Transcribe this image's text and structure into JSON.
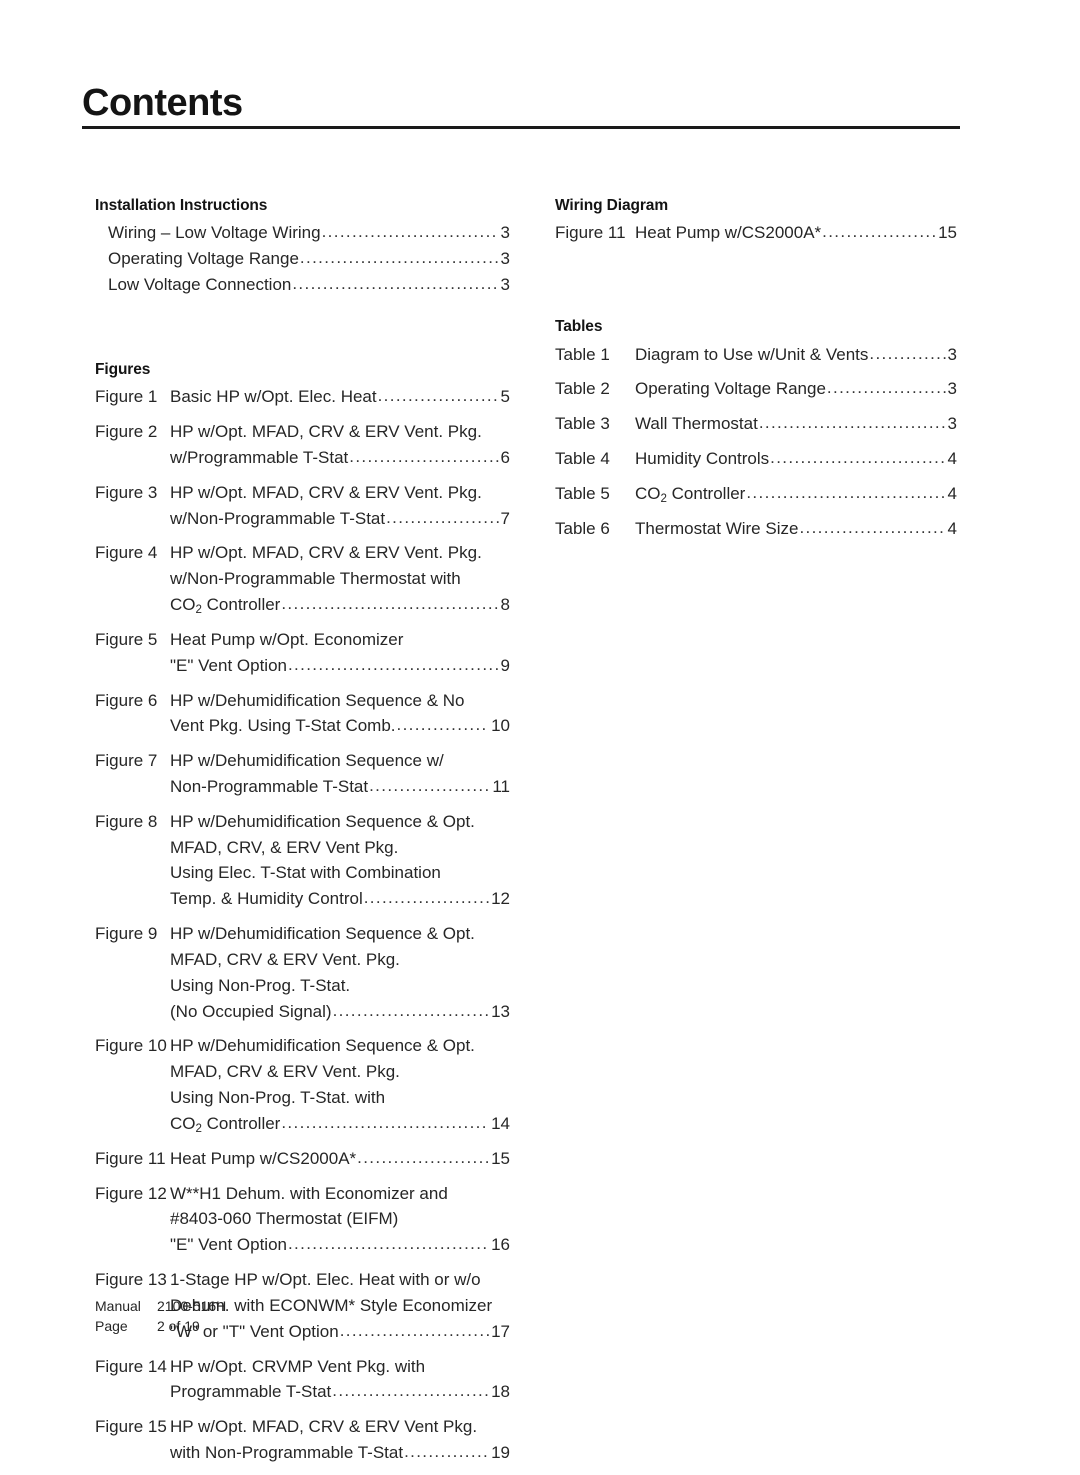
{
  "header": {
    "title": "Contents",
    "rule_color": "#1a1a1a"
  },
  "left_column": {
    "sections": [
      {
        "heading": "Installation Instructions",
        "style": "simple",
        "entries": [
          {
            "text": "Wiring – Low Voltage Wiring",
            "page": "3"
          },
          {
            "text": "Operating Voltage Range",
            "page": "3"
          },
          {
            "text": "Low Voltage Connection",
            "page": "3"
          }
        ]
      },
      {
        "heading": "Figures",
        "style": "numbered",
        "entries": [
          {
            "label": "Figure 1",
            "lines": [
              {
                "text": "Basic HP w/Opt. Elec. Heat",
                "page": "5"
              }
            ]
          },
          {
            "label": "Figure 2",
            "lines": [
              {
                "text": "HP w/Opt. MFAD, CRV & ERV Vent. Pkg."
              },
              {
                "text": "w/Programmable T-Stat",
                "page": "6"
              }
            ]
          },
          {
            "label": "Figure 3",
            "lines": [
              {
                "text": "HP w/Opt. MFAD, CRV & ERV Vent. Pkg."
              },
              {
                "text": "w/Non-Programmable T-Stat",
                "page": "7"
              }
            ]
          },
          {
            "label": "Figure 4",
            "lines": [
              {
                "text": "HP w/Opt. MFAD, CRV & ERV Vent. Pkg."
              },
              {
                "text": "w/Non-Programmable Thermostat with"
              },
              {
                "html": "CO<sub>2</sub> Controller",
                "page": "8"
              }
            ]
          },
          {
            "label": "Figure 5",
            "lines": [
              {
                "text": "Heat Pump w/Opt. Economizer"
              },
              {
                "text": "\"E\" Vent Option",
                "page": "9"
              }
            ]
          },
          {
            "label": "Figure 6",
            "lines": [
              {
                "text": "HP w/Dehumidification Sequence & No"
              },
              {
                "text": "Vent Pkg. Using T-Stat Comb. ",
                "page": "10"
              }
            ]
          },
          {
            "label": "Figure 7",
            "lines": [
              {
                "text": "HP w/Dehumidification Sequence w/"
              },
              {
                "text": "Non-Programmable T-Stat",
                "page": "11"
              }
            ]
          },
          {
            "label": "Figure 8",
            "lines": [
              {
                "text": "HP w/Dehumidification Sequence & Opt."
              },
              {
                "text": "MFAD, CRV, & ERV Vent Pkg."
              },
              {
                "text": "Using Elec. T-Stat with Combination"
              },
              {
                "text": "Temp. & Humidity Control",
                "page": "12"
              }
            ]
          },
          {
            "label": "Figure 9",
            "lines": [
              {
                "text": "HP w/Dehumidification Sequence & Opt."
              },
              {
                "text": "MFAD, CRV & ERV Vent. Pkg."
              },
              {
                "text": "Using Non-Prog. T-Stat."
              },
              {
                "text": "(No Occupied Signal)",
                "page": "13"
              }
            ]
          },
          {
            "label": "Figure 10",
            "lines": [
              {
                "text": "HP w/Dehumidification Sequence & Opt."
              },
              {
                "text": "MFAD, CRV & ERV Vent. Pkg."
              },
              {
                "text": "Using Non-Prog. T-Stat. with"
              },
              {
                "html": "CO<sub>2</sub> Controller",
                "page": "14"
              }
            ]
          },
          {
            "label": "Figure 11",
            "lines": [
              {
                "text": "Heat Pump w/CS2000A*",
                "page": "15"
              }
            ]
          },
          {
            "label": "Figure 12",
            "lines": [
              {
                "text": "W**H1 Dehum. with Economizer and"
              },
              {
                "text": "#8403-060 Thermostat (EIFM)"
              },
              {
                "text": "\"E\" Vent Option",
                "page": "16"
              }
            ]
          },
          {
            "label": "Figure 13",
            "lines": [
              {
                "text": "1-Stage HP w/Opt. Elec. Heat with or w/o"
              },
              {
                "text": "Dehum. with ECONWM* Style Economizer"
              },
              {
                "text": "\"W\" or \"T\" Vent Option",
                "page": "17"
              }
            ]
          },
          {
            "label": "Figure 14",
            "lines": [
              {
                "text": "HP w/Opt. CRVMP Vent Pkg. with"
              },
              {
                "text": "Programmable T-Stat",
                "page": "18"
              }
            ]
          },
          {
            "label": "Figure 15",
            "lines": [
              {
                "text": "HP w/Opt. MFAD, CRV & ERV Vent Pkg."
              },
              {
                "text": "with Non-Programmable T-Stat",
                "page": "19"
              }
            ]
          }
        ]
      }
    ]
  },
  "right_column": {
    "sections": [
      {
        "heading": "Wiring Diagram",
        "style": "numbered",
        "entries": [
          {
            "label": "Figure 11",
            "lines": [
              {
                "text": "Heat Pump w/CS2000A*",
                "page": "15"
              }
            ]
          }
        ]
      },
      {
        "heading": "Tables",
        "style": "numbered",
        "entries": [
          {
            "label": "Table 1",
            "lines": [
              {
                "text": "Diagram to Use w/Unit & Vents",
                "page": "3"
              }
            ]
          },
          {
            "label": "Table 2",
            "lines": [
              {
                "text": "Operating Voltage Range",
                "page": "3"
              }
            ]
          },
          {
            "label": "Table 3",
            "lines": [
              {
                "text": "Wall Thermostat",
                "page": "3"
              }
            ]
          },
          {
            "label": "Table 4",
            "lines": [
              {
                "text": "Humidity Controls",
                "page": "4"
              }
            ]
          },
          {
            "label": "Table 5",
            "lines": [
              {
                "html": "CO<sub>2</sub> Controller",
                "page": "4"
              }
            ]
          },
          {
            "label": "Table 6",
            "lines": [
              {
                "text": "Thermostat Wire Size",
                "page": "4"
              }
            ]
          }
        ]
      }
    ]
  },
  "footer": {
    "manual_key": "Manual",
    "manual_value": "2100-516H",
    "page_key": "Page",
    "page_value": "2 of 19"
  }
}
